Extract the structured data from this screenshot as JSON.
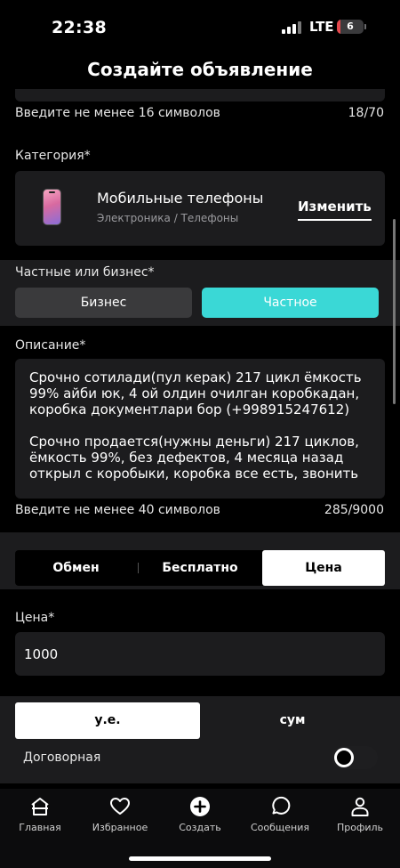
{
  "status_bar": {
    "time": "22:38",
    "network": "LTE",
    "battery_level": "6",
    "battery_fraction": 0.06
  },
  "header": {
    "title": "Создайте объявление"
  },
  "title_field": {
    "hint": "Введите не менее 16 символов",
    "counter": "18/70"
  },
  "category": {
    "label": "Категория*",
    "name": "Мобильные телефоны",
    "path": "Электроника / Телефоны",
    "change_label": "Изменить"
  },
  "owner_type": {
    "label": "Частные или бизнес*",
    "business_label": "Бизнес",
    "private_label": "Частное",
    "selected": "private"
  },
  "description": {
    "label": "Описание*",
    "paragraphs": [
      "Срочно сотилади(пул керак) 217 цикл ёмкость 99% айби юк, 4 ой олдин очилган коробкадан, коробка документлари бор (+998915247612)",
      "Срочно продается(нужны деньги) 217 циклов, ёмкость 99%, без дефектов, 4 месяца назад открыл с коробыки, коробка все есть, звонить"
    ],
    "hint": "Введите не менее 40 символов",
    "counter": "285/9000"
  },
  "deal_tabs": {
    "exchange_label": "Обмен",
    "free_label": "Бесплатно",
    "price_label": "Цена",
    "selected": "price"
  },
  "price": {
    "label": "Цена*",
    "value": "1000"
  },
  "currency": {
    "ue_label": "у.е.",
    "sum_label": "сум",
    "selected": "ue"
  },
  "negotiable": {
    "label": "Договорная",
    "on": false
  },
  "bottom_nav": {
    "home": "Главная",
    "favorites": "Избранное",
    "create": "Создать",
    "messages": "Сообщения",
    "profile": "Профиль"
  },
  "colors": {
    "accent": "#3ad8d6",
    "card": "#1c1c1e",
    "background": "#000000",
    "battery_low": "#e5484d"
  }
}
